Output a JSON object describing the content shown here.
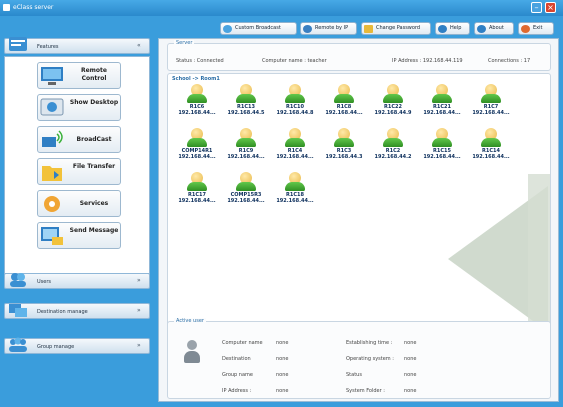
{
  "window": {
    "title": "eClass server"
  },
  "toolbar": {
    "custom_broadcast": "Custom Broadcast",
    "remote_by_ip": "Remote by IP",
    "change_password": "Change Password",
    "help": "Help",
    "about": "About",
    "exit": "Exit"
  },
  "sidebar": {
    "features": {
      "label": "Features",
      "items": [
        {
          "label": "Remote Control",
          "icon": "remote-control-icon"
        },
        {
          "label": "Show Desktop",
          "icon": "show-desktop-icon"
        },
        {
          "label": "BroadCast",
          "icon": "broadcast-icon"
        },
        {
          "label": "File Transfer",
          "icon": "file-transfer-icon"
        },
        {
          "label": "Services",
          "icon": "services-icon"
        },
        {
          "label": "Send Message",
          "icon": "send-message-icon"
        }
      ]
    },
    "users": {
      "label": "Users"
    },
    "destination": {
      "label": "Destination manage"
    },
    "group": {
      "label": "Group manage"
    }
  },
  "server": {
    "legend": "Server",
    "status": "Status : Connected",
    "computer_name": "Computer name : teacher",
    "ip_address": "IP Address : 192.168.44.119",
    "connections": "Connections : 17"
  },
  "room": {
    "title": "School -> Room1",
    "computers": [
      {
        "name": "R1C6",
        "ip": "192.168.44..."
      },
      {
        "name": "R1C13",
        "ip": "192.168.44.5"
      },
      {
        "name": "R1C10",
        "ip": "192.168.44.8"
      },
      {
        "name": "R1C8",
        "ip": "192.168.44..."
      },
      {
        "name": "R1C22",
        "ip": "192.168.44.9"
      },
      {
        "name": "R1C21",
        "ip": "192.168.44..."
      },
      {
        "name": "R1C7",
        "ip": "192.168.44..."
      },
      {
        "name": "COMP14R1",
        "ip": "192.168.44..."
      },
      {
        "name": "R1C9",
        "ip": "192.168.44..."
      },
      {
        "name": "R1C4",
        "ip": "192.168.44..."
      },
      {
        "name": "R1C3",
        "ip": "192.168.44.3"
      },
      {
        "name": "R1C2",
        "ip": "192.168.44.2"
      },
      {
        "name": "R1C15",
        "ip": "192.168.44..."
      },
      {
        "name": "R1C14",
        "ip": "192.168.44..."
      },
      {
        "name": "R1C17",
        "ip": "192.168.44..."
      },
      {
        "name": "COMP15R3",
        "ip": "192.168.44..."
      },
      {
        "name": "R1C18",
        "ip": "192.168.44..."
      }
    ]
  },
  "active": {
    "legend": "Active user",
    "fields": {
      "computer_name": {
        "label": "Computer name",
        "value": "none"
      },
      "destination": {
        "label": "Destination",
        "value": "none"
      },
      "group_name": {
        "label": "Group name",
        "value": "none"
      },
      "ip_address": {
        "label": "IP Address :",
        "value": "none"
      },
      "establishing_time": {
        "label": "Establishing time :",
        "value": "none"
      },
      "operating_system": {
        "label": "Operating system :",
        "value": "none"
      },
      "status": {
        "label": "Status",
        "value": "none"
      },
      "system_folder": {
        "label": "System Folder :",
        "value": "none"
      }
    }
  },
  "colors": {
    "accent": "#3a9ddc",
    "online_body": "#2f8f24",
    "online_head": "#e9b94a",
    "link": "#0d2f5c"
  }
}
